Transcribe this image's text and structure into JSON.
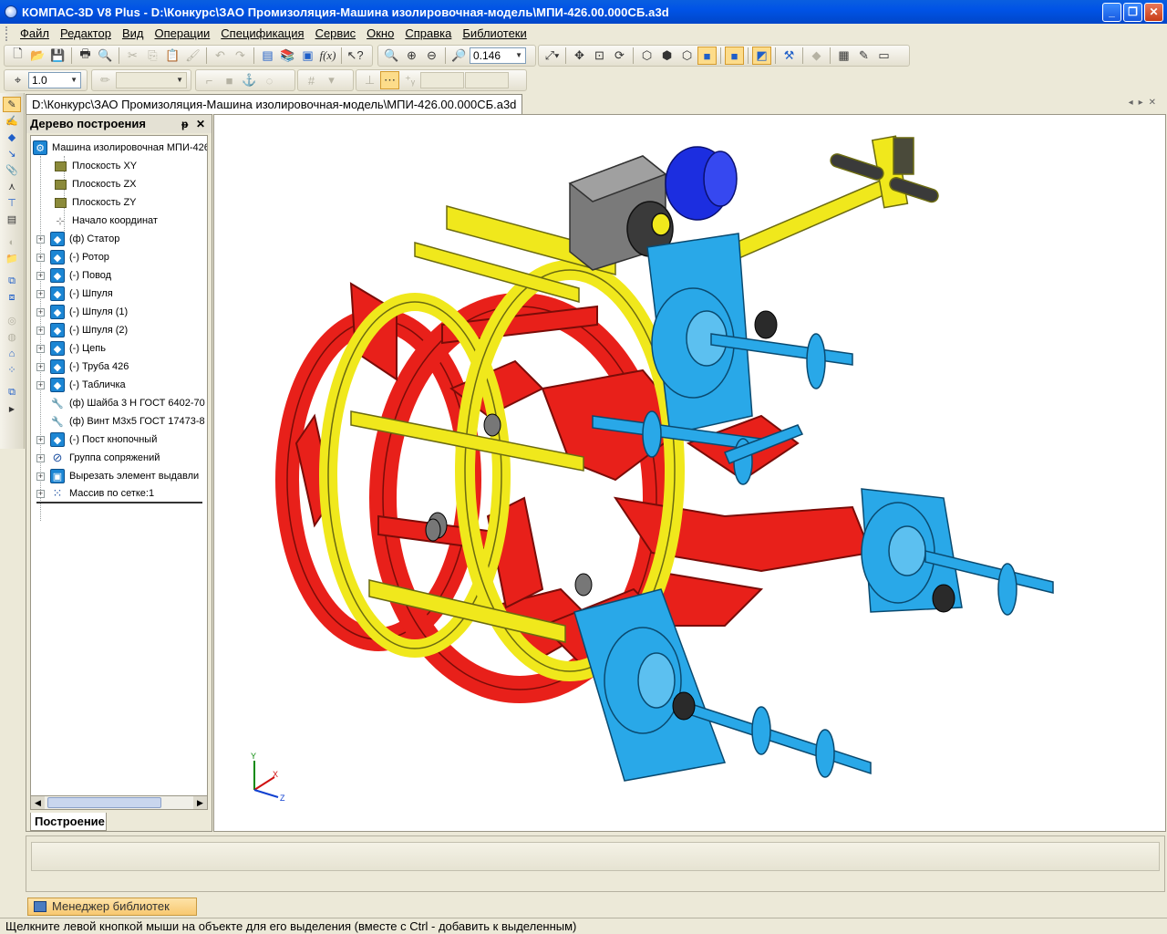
{
  "window": {
    "title": "КОМПАС-3D V8 Plus - D:\\Конкурс\\ЗАО Промизоляция-Машина изолировочная-модель\\МПИ-426.00.000СБ.a3d",
    "minimize": "_",
    "maximize": "❐",
    "close": "✕"
  },
  "menu": {
    "items": [
      {
        "label": "Файл"
      },
      {
        "label": "Редактор"
      },
      {
        "label": "Вид"
      },
      {
        "label": "Операции"
      },
      {
        "label": "Спецификация"
      },
      {
        "label": "Сервис"
      },
      {
        "label": "Окно"
      },
      {
        "label": "Справка"
      },
      {
        "label": "Библиотеки"
      }
    ]
  },
  "toolbar": {
    "zoom_value": "0.146",
    "step_value": "1.0"
  },
  "document": {
    "tab_label": "D:\\Конкурс\\ЗАО Промизоляция-Машина изолировочная-модель\\МПИ-426.00.000СБ.a3d"
  },
  "tree": {
    "header": "Дерево построения",
    "pin": "ᵽ",
    "close": "✕",
    "tab_label": "Построение",
    "nodes": [
      {
        "label": "Машина изолировочная МПИ-426",
        "icon": "assembly-icon"
      },
      {
        "label": "Плоскость XY",
        "icon": "plane-icon"
      },
      {
        "label": "Плоскость ZX",
        "icon": "plane-icon"
      },
      {
        "label": "Плоскость ZY",
        "icon": "plane-icon"
      },
      {
        "label": "Начало координат",
        "icon": "origin-icon"
      },
      {
        "label": "(ф) Статор",
        "icon": "part-icon"
      },
      {
        "label": "(-) Ротор",
        "icon": "part-icon"
      },
      {
        "label": "(-) Повод",
        "icon": "part-icon"
      },
      {
        "label": "(-) Шпуля",
        "icon": "part-icon"
      },
      {
        "label": "(-) Шпуля (1)",
        "icon": "part-icon"
      },
      {
        "label": "(-) Шпуля (2)",
        "icon": "part-icon"
      },
      {
        "label": "(-) Цепь",
        "icon": "part-icon"
      },
      {
        "label": "(-) Труба 426",
        "icon": "part-icon"
      },
      {
        "label": "(-) Табличка",
        "icon": "part-icon"
      },
      {
        "label": "(ф) Шайба 3 Н ГОСТ 6402-70",
        "icon": "standard-part-icon"
      },
      {
        "label": "(ф) Винт М3х5 ГОСТ 17473-8",
        "icon": "standard-part-icon"
      },
      {
        "label": "(-) Пост кнопочный",
        "icon": "part-icon"
      },
      {
        "label": "Группа сопряжений",
        "icon": "mates-icon"
      },
      {
        "label": "Вырезать элемент выдавли",
        "icon": "cut-extrude-icon"
      },
      {
        "label": "Массив по сетке:1",
        "icon": "grid-array-icon"
      }
    ]
  },
  "viewport": {
    "axes": {
      "x": "X",
      "y": "Y",
      "z": "Z"
    },
    "colors": {
      "frame": "#e8201a",
      "rings": "#f0e81c",
      "spools": "#29a8e8",
      "motor": "#1c2ee0",
      "gearbox": "#7a7a7a"
    }
  },
  "library_manager": {
    "label": "Менеджер библиотек"
  },
  "status": {
    "text": "Щелкните левой кнопкой мыши на объекте для его выделения (вместе с Ctrl - добавить к выделенным)"
  }
}
